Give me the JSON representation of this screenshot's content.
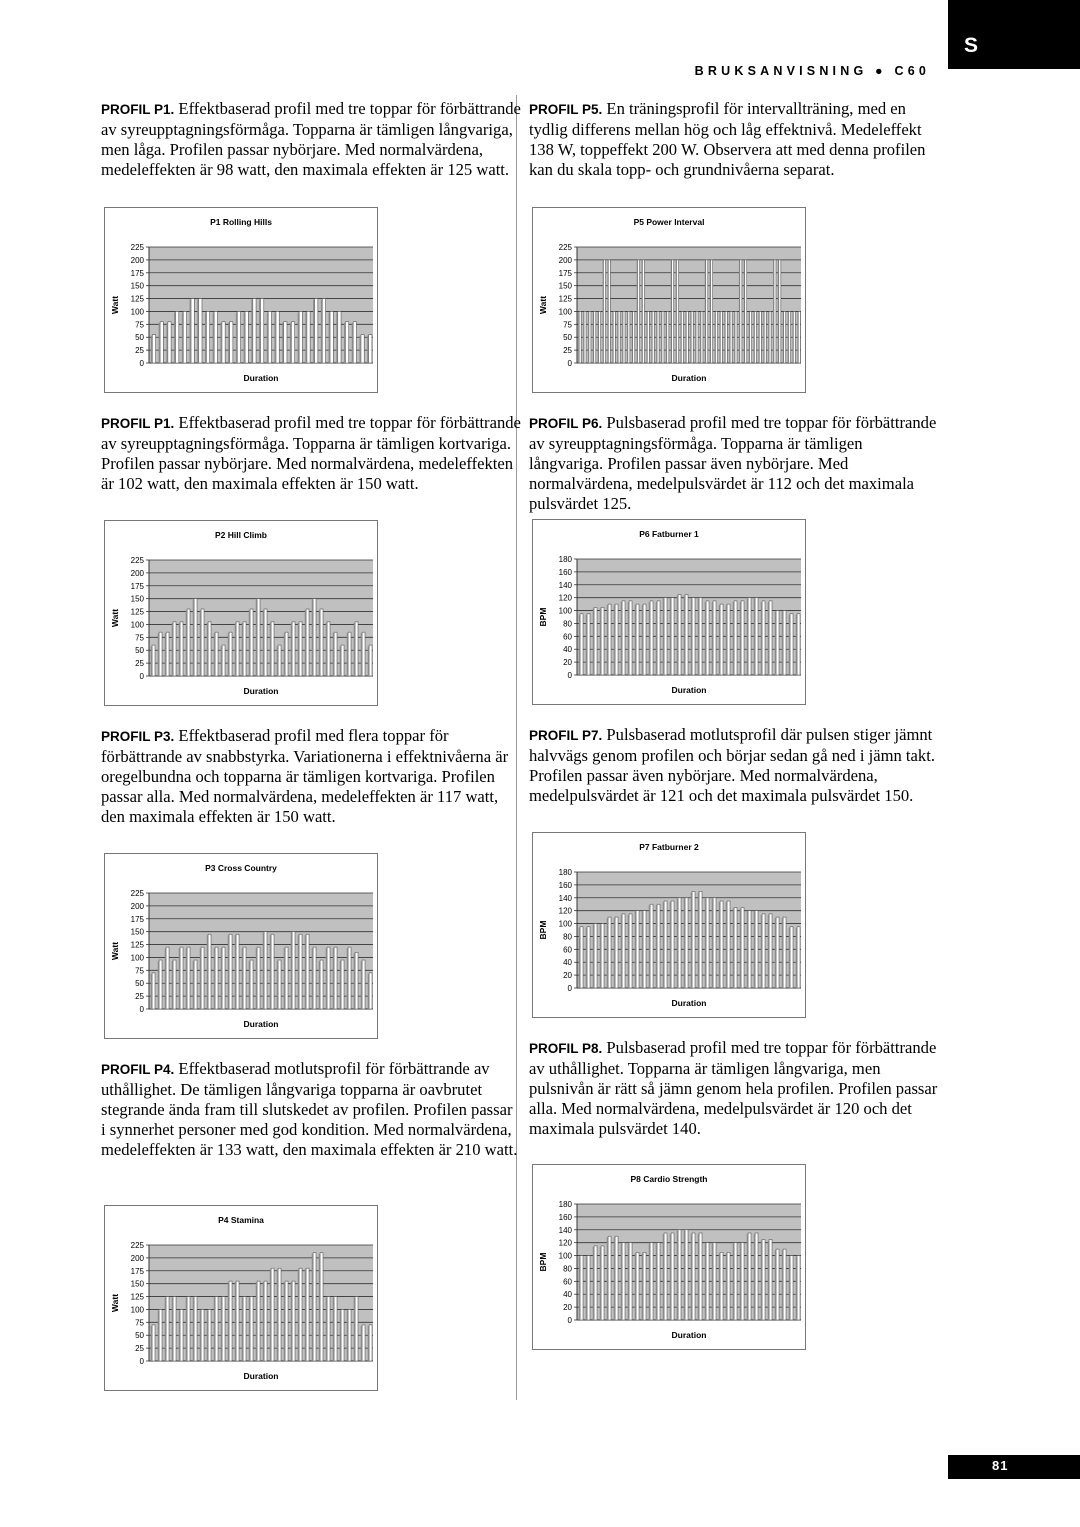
{
  "header": {
    "lang_tab": "S",
    "manual_title": "BRUKSANVISNING ● C60"
  },
  "footer": {
    "page_number": "81"
  },
  "sections": [
    {
      "id": "p1a",
      "lead": "PROFIL P1.",
      "text": " Effektbaserad profil med tre toppar för förbättrande av syreupptagningsförmåga. Topparna är tämligen långvariga, men låga. Profilen passar nybörjare. Med normalvärdena, medeleffekten är 98 watt, den maximala effekten är 125 watt."
    },
    {
      "id": "p5",
      "lead": "PROFIL P5.",
      "text": " En träningsprofil för intervallträning, med en tydlig differens mellan hög och låg effektnivå. Medeleffekt 138 W, toppeffekt 200 W. Observera att med denna profilen kan du skala topp- och grundnivåerna separat."
    },
    {
      "id": "p1b",
      "lead": "PROFIL P1.",
      "text": " Effektbaserad profil med tre toppar för förbättrande av syreupptagningsförmåga. Topparna är tämligen kortvariga. Profilen passar nybörjare. Med normalvärdena, medeleffekten är 102 watt, den maximala effekten är 150 watt."
    },
    {
      "id": "p6",
      "lead": "PROFIL P6.",
      "text": " Pulsbaserad profil med tre toppar för förbättrande av syreupptagningsförmåga. Topparna är tämligen långvariga. Profilen passar även nybörjare. Med normalvärdena, medelpulsvärdet är 112 och det maximala pulsvärdet 125."
    },
    {
      "id": "p3",
      "lead": "PROFIL P3.",
      "text": " Effektbaserad profil med flera toppar för förbättrande av snabbstyrka. Variationerna i effektnivåerna är oregelbundna och topparna är tämligen kortvariga. Profilen passar alla. Med normalvärdena, medeleffekten är 117 watt, den maximala effekten är 150 watt."
    },
    {
      "id": "p7",
      "lead": "PROFIL P7.",
      "text": " Pulsbaserad motlutsprofil där pulsen stiger jämnt halvvägs genom profilen och börjar sedan gå ned i jämn takt. Profilen passar även nybörjare. Med normalvärdena, medelpulsvärdet är 121 och det maximala pulsvärdet 150."
    },
    {
      "id": "p4",
      "lead": "PROFIL P4.",
      "text": " Effektbaserad motlutsprofil för förbättrande av uthållighet. De tämligen långvariga topparna är oavbrutet stegrande ända fram till slutskedet av profilen. Profilen passar i synnerhet personer med god kondition. Med normalvärdena, medeleffekten är 133 watt, den maximala effekten är 210 watt."
    },
    {
      "id": "p8",
      "lead": "PROFIL P8.",
      "text": " Pulsbaserad profil med tre toppar för förbättrande av uthållighet. Topparna är tämligen långvariga, men pulsnivån är rätt så jämn genom hela profilen. Profilen passar alla. Med normalvärdena, medelpulsvärdet är 120 och det maximala pulsvärdet 140."
    }
  ],
  "chart_data": [
    {
      "id": "p1",
      "type": "bar",
      "title": "P1 Rolling Hills",
      "xlabel": "Duration",
      "ylabel": "Watt",
      "ylim": [
        0,
        225
      ],
      "yticks": [
        0,
        25,
        50,
        75,
        100,
        125,
        150,
        175,
        200,
        225
      ],
      "grid": true,
      "values": [
        55,
        80,
        80,
        100,
        100,
        125,
        125,
        100,
        100,
        80,
        80,
        100,
        100,
        125,
        125,
        100,
        100,
        80,
        80,
        100,
        100,
        125,
        125,
        100,
        100,
        80,
        80,
        55,
        55
      ]
    },
    {
      "id": "p5",
      "type": "bar",
      "title": "P5 Power Interval",
      "xlabel": "Duration",
      "ylabel": "Watt",
      "ylim": [
        0,
        225
      ],
      "yticks": [
        0,
        25,
        50,
        75,
        100,
        125,
        150,
        175,
        200,
        225
      ],
      "grid": true,
      "values": [
        100,
        100,
        100,
        100,
        100,
        200,
        200,
        100,
        100,
        100,
        100,
        100,
        200,
        200,
        100,
        100,
        100,
        100,
        100,
        200,
        200,
        100,
        100,
        100,
        100,
        100,
        200,
        200,
        100,
        100,
        100,
        100,
        100,
        200,
        200,
        100,
        100,
        100,
        100,
        100,
        200,
        200,
        100,
        100,
        100,
        100
      ]
    },
    {
      "id": "p2",
      "type": "bar",
      "title": "P2 Hill Climb",
      "xlabel": "Duration",
      "ylabel": "Watt",
      "ylim": [
        0,
        225
      ],
      "yticks": [
        0,
        25,
        50,
        75,
        100,
        125,
        150,
        175,
        200,
        225
      ],
      "grid": true,
      "values": [
        60,
        85,
        85,
        105,
        105,
        130,
        150,
        130,
        105,
        85,
        60,
        85,
        105,
        105,
        130,
        150,
        130,
        105,
        60,
        85,
        105,
        105,
        130,
        150,
        130,
        105,
        85,
        60,
        85,
        105,
        85,
        60
      ]
    },
    {
      "id": "p6",
      "type": "bar",
      "title": "P6 Fatburner 1",
      "xlabel": "Duration",
      "ylabel": "BPM",
      "ylim": [
        0,
        180
      ],
      "yticks": [
        0,
        20,
        40,
        60,
        80,
        100,
        120,
        140,
        160,
        180
      ],
      "grid": true,
      "values": [
        95,
        95,
        105,
        105,
        110,
        110,
        115,
        115,
        110,
        110,
        115,
        115,
        120,
        120,
        125,
        125,
        120,
        120,
        115,
        115,
        110,
        110,
        115,
        115,
        120,
        120,
        115,
        115,
        100,
        100,
        95,
        95
      ]
    },
    {
      "id": "p3",
      "type": "bar",
      "title": "P3 Cross Country",
      "xlabel": "Duration",
      "ylabel": "Watt",
      "ylim": [
        0,
        225
      ],
      "yticks": [
        0,
        25,
        50,
        75,
        100,
        125,
        150,
        175,
        200,
        225
      ],
      "grid": true,
      "values": [
        70,
        95,
        120,
        95,
        120,
        120,
        95,
        120,
        145,
        120,
        120,
        145,
        145,
        120,
        95,
        120,
        150,
        145,
        95,
        120,
        150,
        145,
        145,
        120,
        95,
        120,
        120,
        95,
        120,
        110,
        95,
        70
      ]
    },
    {
      "id": "p7",
      "type": "bar",
      "title": "P7 Fatburner 2",
      "xlabel": "Duration",
      "ylabel": "BPM",
      "ylim": [
        0,
        180
      ],
      "yticks": [
        0,
        20,
        40,
        60,
        80,
        100,
        120,
        140,
        160,
        180
      ],
      "grid": true,
      "values": [
        95,
        95,
        100,
        100,
        110,
        110,
        115,
        115,
        120,
        120,
        130,
        130,
        135,
        135,
        140,
        140,
        150,
        150,
        140,
        140,
        135,
        135,
        125,
        125,
        120,
        120,
        115,
        115,
        110,
        110,
        95,
        95
      ]
    },
    {
      "id": "p4",
      "type": "bar",
      "title": "P4 Stamina",
      "xlabel": "Duration",
      "ylabel": "Watt",
      "ylim": [
        0,
        225
      ],
      "yticks": [
        0,
        25,
        50,
        75,
        100,
        125,
        150,
        175,
        200,
        225
      ],
      "grid": true,
      "values": [
        70,
        100,
        125,
        125,
        100,
        125,
        125,
        100,
        100,
        125,
        125,
        155,
        155,
        125,
        125,
        155,
        155,
        180,
        180,
        155,
        155,
        180,
        180,
        210,
        210,
        125,
        125,
        100,
        100,
        125,
        70,
        70
      ]
    },
    {
      "id": "p8",
      "type": "bar",
      "title": "P8 Cardio Strength",
      "xlabel": "Duration",
      "ylabel": "BPM",
      "ylim": [
        0,
        180
      ],
      "yticks": [
        0,
        20,
        40,
        60,
        80,
        100,
        120,
        140,
        160,
        180
      ],
      "grid": true,
      "values": [
        100,
        100,
        115,
        115,
        130,
        130,
        120,
        120,
        105,
        105,
        120,
        120,
        135,
        135,
        140,
        140,
        135,
        135,
        120,
        120,
        105,
        105,
        120,
        120,
        135,
        135,
        125,
        125,
        110,
        110,
        100,
        100
      ]
    }
  ]
}
